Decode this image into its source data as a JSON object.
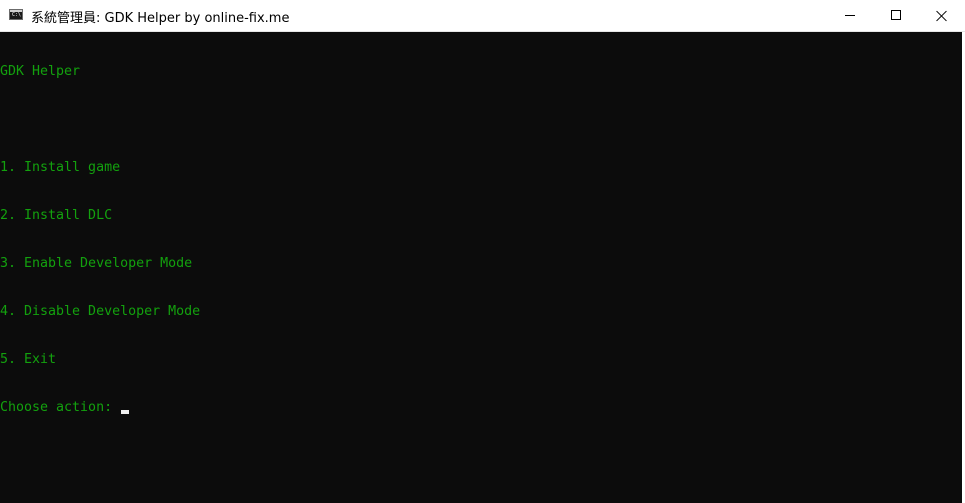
{
  "window": {
    "title": "系統管理員:  GDK Helper by online-fix.me",
    "app_icon": "console-window-icon",
    "app_icon_text": "C:\\",
    "controls": {
      "minimize_icon": "minimize-icon",
      "maximize_icon": "maximize-icon",
      "close_icon": "close-icon"
    }
  },
  "console": {
    "text_color": "#13a10e",
    "background": "#0c0c0c",
    "header": "GDK Helper",
    "menu": [
      "1. Install game",
      "2. Install DLC",
      "3. Enable Developer Mode",
      "4. Disable Developer Mode",
      "5. Exit"
    ],
    "prompt": "Choose action: ",
    "input_value": ""
  }
}
